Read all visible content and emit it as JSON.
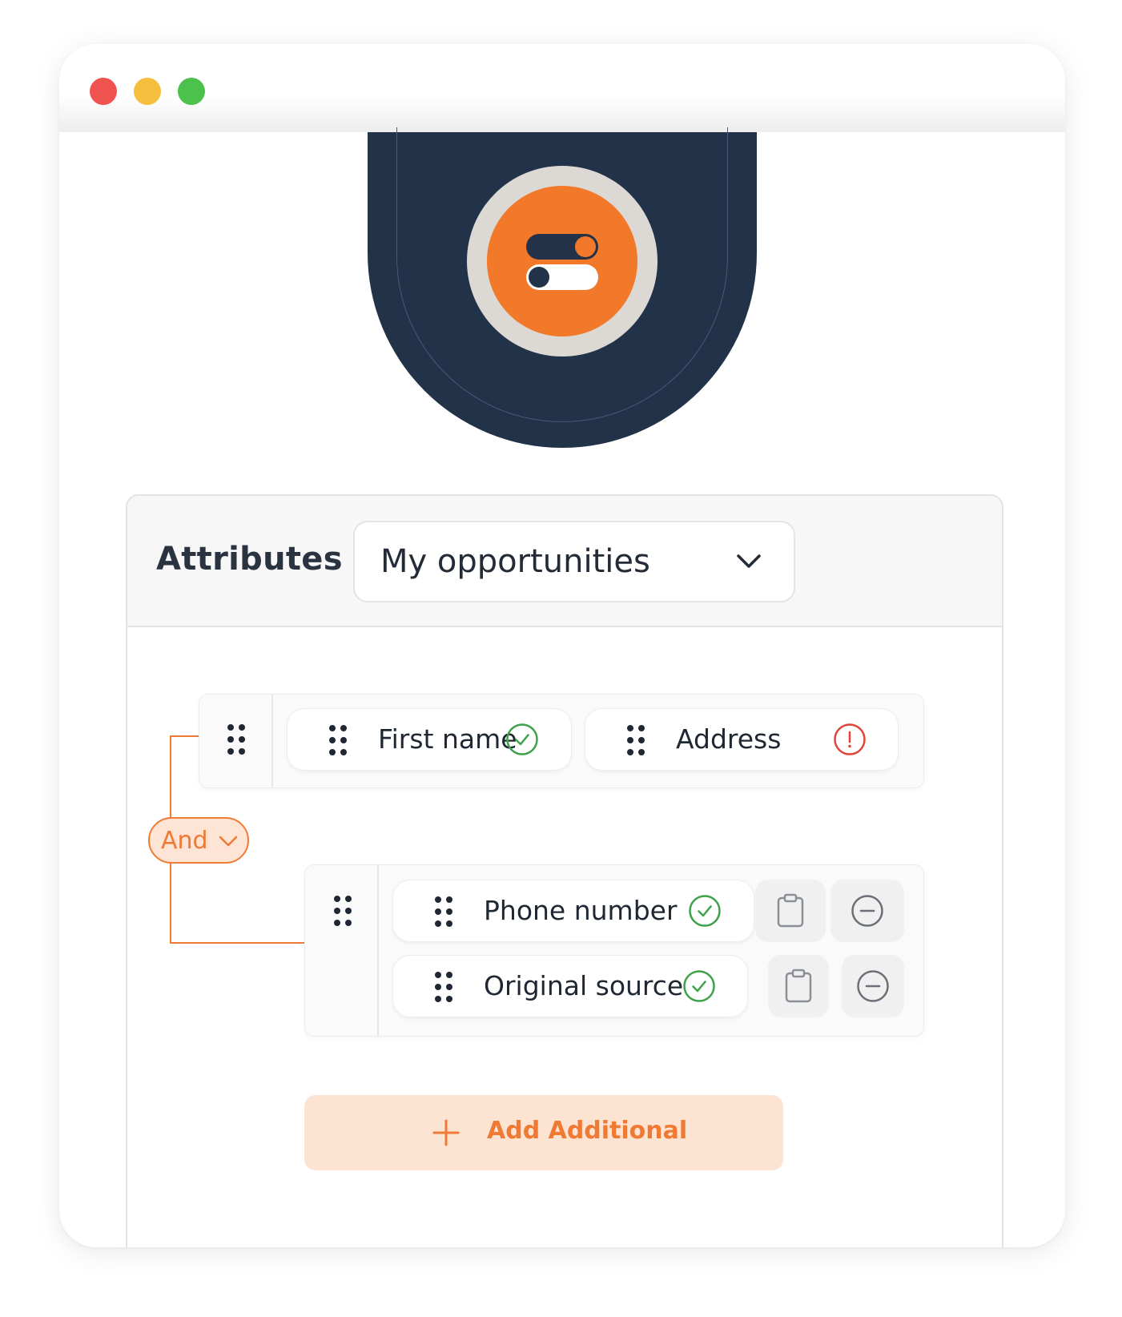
{
  "window": {
    "controls": [
      "close",
      "minimize",
      "maximize"
    ]
  },
  "badge": {
    "icon": "toggle-switches-icon",
    "colors": {
      "navy": "#223249",
      "orange": "#f2782a"
    }
  },
  "header": {
    "label": "Attributes",
    "select": {
      "value": "My opportunities",
      "icon": "chevron-down-icon"
    }
  },
  "logic": {
    "operator": "And",
    "operator_icon": "chevron-down-icon",
    "accent": "#ef7a34"
  },
  "groups": [
    {
      "fields": [
        {
          "label": "First name",
          "status": "valid",
          "status_icon": "check-circle-icon"
        },
        {
          "label": "Address",
          "status": "error",
          "status_icon": "alert-circle-icon"
        }
      ]
    },
    {
      "fields": [
        {
          "label": "Phone number",
          "status": "valid",
          "status_icon": "check-circle-icon"
        },
        {
          "label": "Original source",
          "status": "valid",
          "status_icon": "check-circle-icon"
        }
      ]
    }
  ],
  "colors": {
    "valid": "#3fa14a",
    "error": "#e0453a"
  },
  "footer": {
    "add_label": "Add Additional",
    "add_icon": "plus-icon"
  }
}
